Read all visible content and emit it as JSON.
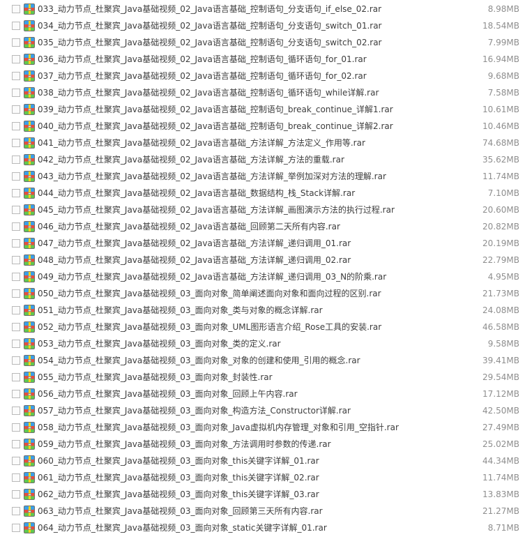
{
  "files": [
    {
      "name": "033_动力节点_杜聚宾_Java基础视频_02_Java语言基础_控制语句_分支语句_if_else_02.rar",
      "size": "8.98MB"
    },
    {
      "name": "034_动力节点_杜聚宾_Java基础视频_02_Java语言基础_控制语句_分支语句_switch_01.rar",
      "size": "18.54MB"
    },
    {
      "name": "035_动力节点_杜聚宾_Java基础视频_02_Java语言基础_控制语句_分支语句_switch_02.rar",
      "size": "7.99MB"
    },
    {
      "name": "036_动力节点_杜聚宾_Java基础视频_02_Java语言基础_控制语句_循环语句_for_01.rar",
      "size": "16.94MB"
    },
    {
      "name": "037_动力节点_杜聚宾_Java基础视频_02_Java语言基础_控制语句_循环语句_for_02.rar",
      "size": "9.68MB"
    },
    {
      "name": "038_动力节点_杜聚宾_Java基础视频_02_Java语言基础_控制语句_循环语句_while详解.rar",
      "size": "7.58MB"
    },
    {
      "name": "039_动力节点_杜聚宾_Java基础视频_02_Java语言基础_控制语句_break_continue_详解1.rar",
      "size": "10.61MB"
    },
    {
      "name": "040_动力节点_杜聚宾_Java基础视频_02_Java语言基础_控制语句_break_continue_详解2.rar",
      "size": "10.46MB"
    },
    {
      "name": "041_动力节点_杜聚宾_Java基础视频_02_Java语言基础_方法详解_方法定义_作用等.rar",
      "size": "74.68MB"
    },
    {
      "name": "042_动力节点_杜聚宾_Java基础视频_02_Java语言基础_方法详解_方法的重载.rar",
      "size": "35.62MB"
    },
    {
      "name": "043_动力节点_杜聚宾_Java基础视频_02_Java语言基础_方法详解_举例加深对方法的理解.rar",
      "size": "11.74MB"
    },
    {
      "name": "044_动力节点_杜聚宾_Java基础视频_02_Java语言基础_数据结构_栈_Stack详解.rar",
      "size": "7.10MB"
    },
    {
      "name": "045_动力节点_杜聚宾_Java基础视频_02_Java语言基础_方法详解_画图演示方法的执行过程.rar",
      "size": "20.60MB"
    },
    {
      "name": "046_动力节点_杜聚宾_Java基础视频_02_Java语言基础_回顾第二天所有内容.rar",
      "size": "20.82MB"
    },
    {
      "name": "047_动力节点_杜聚宾_Java基础视频_02_Java语言基础_方法详解_递归调用_01.rar",
      "size": "20.19MB"
    },
    {
      "name": "048_动力节点_杜聚宾_Java基础视频_02_Java语言基础_方法详解_递归调用_02.rar",
      "size": "22.79MB"
    },
    {
      "name": "049_动力节点_杜聚宾_Java基础视频_02_Java语言基础_方法详解_递归调用_03_N的阶乘.rar",
      "size": "4.95MB"
    },
    {
      "name": "050_动力节点_杜聚宾_Java基础视频_03_面向对象_简单阐述面向对象和面向过程的区别.rar",
      "size": "21.73MB"
    },
    {
      "name": "051_动力节点_杜聚宾_Java基础视频_03_面向对象_类与对象的概念详解.rar",
      "size": "24.08MB"
    },
    {
      "name": "052_动力节点_杜聚宾_Java基础视频_03_面向对象_UML图形语言介绍_Rose工具的安装.rar",
      "size": "46.58MB"
    },
    {
      "name": "053_动力节点_杜聚宾_Java基础视频_03_面向对象_类的定义.rar",
      "size": "9.58MB"
    },
    {
      "name": "054_动力节点_杜聚宾_Java基础视频_03_面向对象_对象的创建和使用_引用的概念.rar",
      "size": "39.41MB"
    },
    {
      "name": "055_动力节点_杜聚宾_Java基础视频_03_面向对象_封装性.rar",
      "size": "29.54MB"
    },
    {
      "name": "056_动力节点_杜聚宾_Java基础视频_03_面向对象_回顾上午内容.rar",
      "size": "17.12MB"
    },
    {
      "name": "057_动力节点_杜聚宾_Java基础视频_03_面向对象_构造方法_Constructor详解.rar",
      "size": "42.50MB"
    },
    {
      "name": "058_动力节点_杜聚宾_Java基础视频_03_面向对象_Java虚拟机内存管理_对象和引用_空指针.rar",
      "size": "27.49MB"
    },
    {
      "name": "059_动力节点_杜聚宾_Java基础视频_03_面向对象_方法调用时参数的传递.rar",
      "size": "25.02MB"
    },
    {
      "name": "060_动力节点_杜聚宾_Java基础视频_03_面向对象_this关键字详解_01.rar",
      "size": "44.34MB"
    },
    {
      "name": "061_动力节点_杜聚宾_Java基础视频_03_面向对象_this关键字详解_02.rar",
      "size": "11.74MB"
    },
    {
      "name": "062_动力节点_杜聚宾_Java基础视频_03_面向对象_this关键字详解_03.rar",
      "size": "13.83MB"
    },
    {
      "name": "063_动力节点_杜聚宾_Java基础视频_03_面向对象_回顾第三天所有内容.rar",
      "size": "21.27MB"
    },
    {
      "name": "064_动力节点_杜聚宾_Java基础视频_03_面向对象_static关键字详解_01.rar",
      "size": "8.71MB"
    }
  ],
  "file_icon": "rar-archive-icon",
  "checkbox_checked": false
}
